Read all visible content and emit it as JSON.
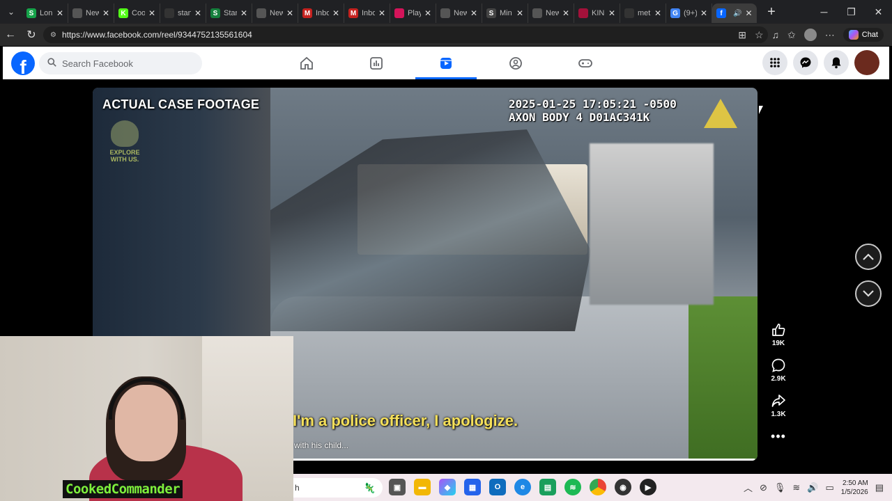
{
  "browser": {
    "tabs": [
      {
        "label": "Lon",
        "favicon": "S",
        "color": "#16a34a"
      },
      {
        "label": "New",
        "favicon": "tab-icon",
        "color": "#555555"
      },
      {
        "label": "Coo",
        "favicon": "K",
        "color": "#53fc18"
      },
      {
        "label": "stan",
        "favicon": "search-icon",
        "color": "#333333"
      },
      {
        "label": "Star",
        "favicon": "S",
        "color": "#15803d"
      },
      {
        "label": "New",
        "favicon": "tab-icon",
        "color": "#555555"
      },
      {
        "label": "Inbo",
        "favicon": "M",
        "color": "#c5221f"
      },
      {
        "label": "Inbo",
        "favicon": "M",
        "color": "#c5221f"
      },
      {
        "label": "Play",
        "favicon": "pluto",
        "color": "#d4145a"
      },
      {
        "label": "New",
        "favicon": "tab-icon",
        "color": "#555555"
      },
      {
        "label": "Min",
        "favicon": "S",
        "color": "#444444"
      },
      {
        "label": "New",
        "favicon": "tab-icon",
        "color": "#555555"
      },
      {
        "label": "KIN",
        "favicon": "play",
        "color": "#a3113a"
      },
      {
        "label": "met",
        "favicon": "search-icon",
        "color": "#333333"
      },
      {
        "label": "(9+)",
        "favicon": "G",
        "color": "#4285f4"
      },
      {
        "label": "",
        "favicon": "f",
        "color": "#0866ff"
      }
    ],
    "url": "https://www.facebook.com/reel/934475213556160​4",
    "chat_label": "Chat"
  },
  "facebook": {
    "logo": "f",
    "search_placeholder": "Search Facebook",
    "nav": [
      "home-icon",
      "dashboard-icon",
      "reels-icon",
      "groups-icon",
      "gaming-icon"
    ],
    "active_nav": "reels-icon"
  },
  "video": {
    "label": "ACTUAL CASE FOOTAGE",
    "watermark": "EXPLORE WITH US.",
    "stamp_line1": "2025-01-25 17:05:21 -0500",
    "stamp_line2": "AXON BODY 4 D01AC341K",
    "caption": "I'm a police officer, I apologize.",
    "subcaption": "with his child...",
    "progress": 0.996
  },
  "actions": {
    "likes": "19K",
    "comments": "2.9K",
    "shares": "1.3K"
  },
  "webcam": {
    "username": "CookedCommander"
  },
  "taskbar": {
    "search_text": "h",
    "time": "2:50 AM",
    "date": "1/5/2026"
  },
  "colors": {
    "facebook_blue": "#0866ff",
    "caption_yellow": "#f5e05a",
    "username_green": "#7ef03c"
  }
}
